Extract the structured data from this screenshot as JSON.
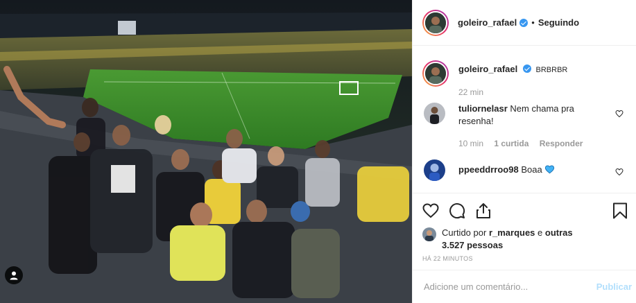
{
  "post": {
    "author": "goleiro_rafael",
    "follow_status": "Seguindo",
    "caption": "BRBRBR",
    "caption_time": "22 min",
    "photo_alt": "Group photo in a football stadium"
  },
  "comments": [
    {
      "user": "tuliornelasr",
      "text": "Nem chama pra resenha!",
      "time": "10 min",
      "likes_label": "1 curtida",
      "reply_label": "Responder"
    },
    {
      "user": "ppeeddrroo98",
      "text": "Boaa"
    }
  ],
  "likes": {
    "prefix": "Curtido por",
    "by_user": "r_marques",
    "connector": "e",
    "others": "outras 3.527 pessoas",
    "time": "HÁ 22 MINUTOS"
  },
  "add_comment": {
    "placeholder": "Adicione um comentário...",
    "publish_label": "Publicar"
  },
  "icons": {
    "like": "heart-icon",
    "comment": "comment-icon",
    "share": "share-icon",
    "save": "bookmark-icon",
    "verified": "verified-badge-icon",
    "tag": "user-tag-icon"
  },
  "colors": {
    "verified": "#3897f0",
    "pitch": "#3f8f2c",
    "publish_disabled": "#b2dffc",
    "story_ring_start": "#f9b43a",
    "story_ring_end": "#a33ab4"
  }
}
